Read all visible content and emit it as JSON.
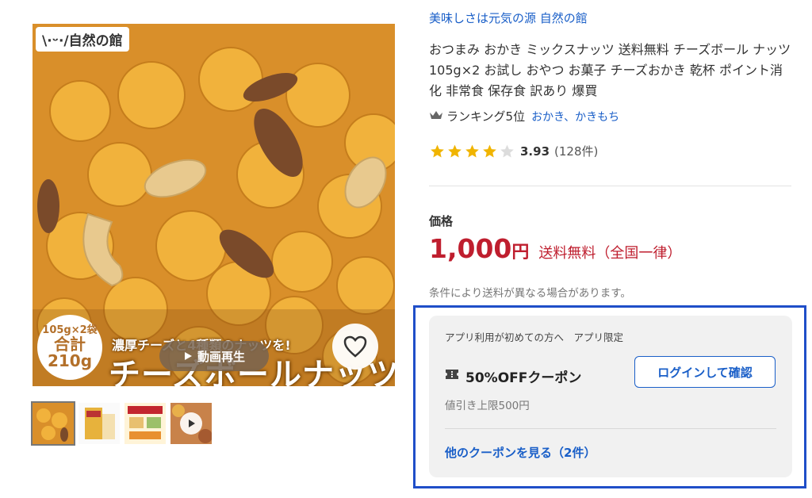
{
  "image": {
    "brand_logo": "\\·ᵕ·/自然の館",
    "pack_badge_line1": "105g×2袋",
    "pack_badge_line2": "合計210g",
    "banner_sub": "濃厚チーズと4種類のナッツを!",
    "banner_main": "チーズボールナッツ",
    "video_button": "動画再生",
    "favorite_icon": "heart-outline-icon"
  },
  "thumbnails": [
    {
      "name": "thumb-1",
      "active": true
    },
    {
      "name": "thumb-2",
      "active": false
    },
    {
      "name": "thumb-3",
      "active": false
    },
    {
      "name": "thumb-4-video",
      "active": false
    }
  ],
  "shop": {
    "name": "美味しさは元気の源 自然の館"
  },
  "product": {
    "title": "おつまみ おかき ミックスナッツ 送料無料 チーズボール ナッツ 105g×2 お試し おやつ お菓子 チーズおかき 乾杯 ポイント消化 非常食 保存食 訳あり 爆買"
  },
  "ranking": {
    "text": "ランキング5位",
    "category": "おかき、かきもち",
    "icon": "crown-icon"
  },
  "rating": {
    "score": "3.93",
    "count": "(128件)",
    "stars_filled": 4,
    "stars_total": 5
  },
  "price": {
    "label": "価格",
    "amount": "1,000",
    "unit": "円",
    "shipping": "送料無料（全国一律）",
    "note": "条件により送料が異なる場合があります。"
  },
  "coupon": {
    "target": "アプリ利用が初めての方へ　アプリ限定",
    "title": "50%OFFクーポン",
    "title_icon": "coupon-ticket-icon",
    "limit": "値引き上限500円",
    "login_button": "ログインして確認",
    "more_link": "他のクーポンを見る（2件）"
  },
  "colors": {
    "price_red": "#bf1e2e",
    "link_blue": "#1a5fc8",
    "highlight_frame": "#1f4ec8",
    "star_gold": "#f0b400"
  }
}
